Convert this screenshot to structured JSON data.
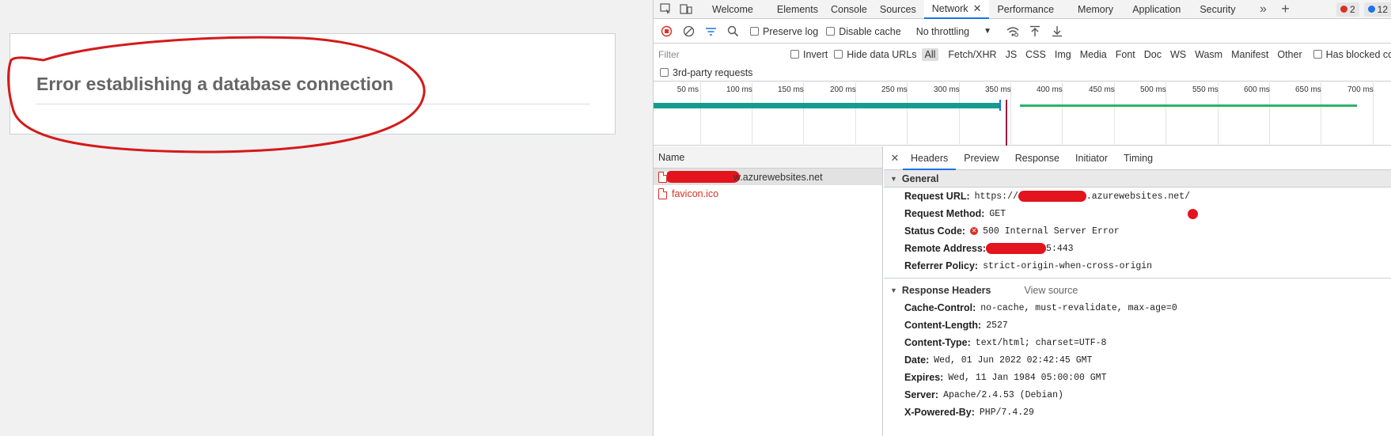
{
  "page": {
    "error_title": "Error establishing a database connection"
  },
  "devtools": {
    "tabs": [
      {
        "label": "Welcome"
      },
      {
        "label": "Elements"
      },
      {
        "label": "Console"
      },
      {
        "label": "Sources"
      },
      {
        "label": "Network"
      },
      {
        "label": "Performance"
      },
      {
        "label": "Memory"
      },
      {
        "label": "Application"
      },
      {
        "label": "Security"
      }
    ],
    "error_count": "2",
    "message_count": "12",
    "toolbar": {
      "preserve_log": "Preserve log",
      "disable_cache": "Disable cache",
      "throttling": "No throttling"
    },
    "filter": {
      "placeholder": "Filter",
      "invert": "Invert",
      "hide_data_urls": "Hide data URLs",
      "types": [
        "All",
        "Fetch/XHR",
        "JS",
        "CSS",
        "Img",
        "Media",
        "Font",
        "Doc",
        "WS",
        "Wasm",
        "Manifest",
        "Other"
      ],
      "has_blocked_cookies": "Has blocked cookies",
      "third_party": "3rd-party requests"
    },
    "timeline": {
      "labels": [
        "50 ms",
        "100 ms",
        "150 ms",
        "200 ms",
        "250 ms",
        "300 ms",
        "350 ms",
        "400 ms",
        "450 ms",
        "500 ms",
        "550 ms",
        "600 ms",
        "650 ms",
        "700 ms"
      ],
      "colors": {
        "bar1": "#169c8f",
        "bar2": "#2eb26a",
        "marker_blue": "#1a73e8",
        "marker_red": "#9c1b3b"
      }
    },
    "requests": {
      "header": "Name",
      "items": [
        {
          "name": "w.azurewebsites.net"
        },
        {
          "name": "favicon.ico"
        }
      ]
    },
    "detail": {
      "tabs": [
        "Headers",
        "Preview",
        "Response",
        "Initiator",
        "Timing"
      ],
      "general": {
        "title": "General",
        "request_url_key": "Request URL:",
        "request_url_prefix": "https://",
        "request_url_suffix": ".azurewebsites.net/",
        "request_method_key": "Request Method:",
        "request_method": "GET",
        "status_code_key": "Status Code:",
        "status_code": "500 Internal Server Error",
        "remote_address_key": "Remote Address:",
        "remote_address_suffix": "5:443",
        "referrer_policy_key": "Referrer Policy:",
        "referrer_policy": "strict-origin-when-cross-origin"
      },
      "response_headers": {
        "title": "Response Headers",
        "view_source": "View source",
        "rows": [
          {
            "key": "Cache-Control:",
            "value": "no-cache, must-revalidate, max-age=0"
          },
          {
            "key": "Content-Length:",
            "value": "2527"
          },
          {
            "key": "Content-Type:",
            "value": "text/html; charset=UTF-8"
          },
          {
            "key": "Date:",
            "value": "Wed, 01 Jun 2022 02:42:45 GMT"
          },
          {
            "key": "Expires:",
            "value": "Wed, 11 Jan 1984 05:00:00 GMT"
          },
          {
            "key": "Server:",
            "value": "Apache/2.4.53 (Debian)"
          },
          {
            "key": "X-Powered-By:",
            "value": "PHP/7.4.29"
          }
        ]
      }
    }
  }
}
